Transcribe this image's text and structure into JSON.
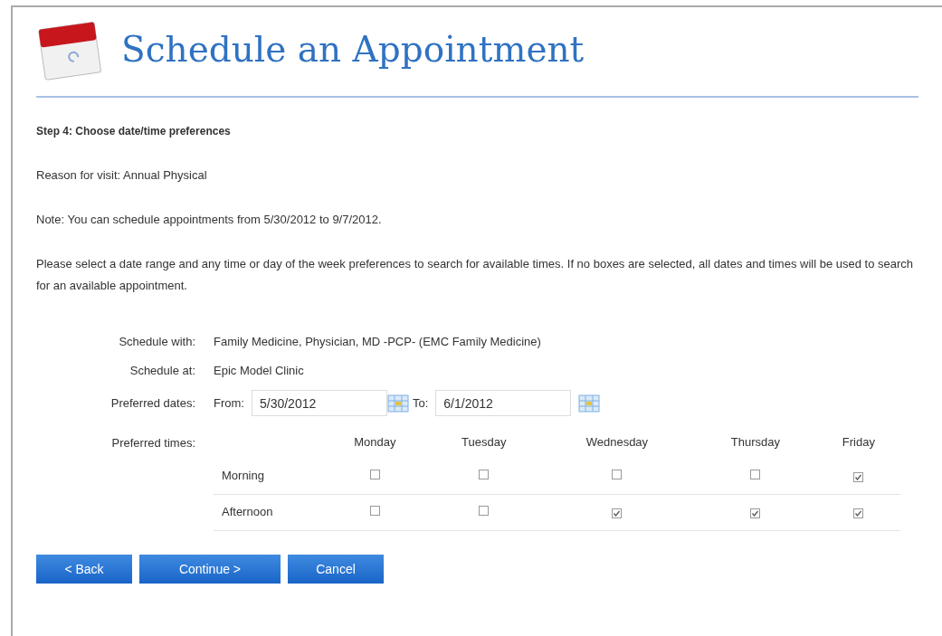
{
  "title": "Schedule an Appointment",
  "step": "Step 4: Choose date/time preferences",
  "paragraphs": [
    "Reason for visit: Annual Physical",
    "Note: You can schedule appointments from 5/30/2012 to 9/7/2012.",
    "Please select a date range and any time or day of the week preferences to search for available times. If no boxes are selected, all dates and times will be used to search for an available appointment."
  ],
  "details": [
    {
      "label": "Schedule with:",
      "value": "Family Medicine, Physician, MD -PCP- (EMC Family Medicine)"
    },
    {
      "label": "Schedule at:",
      "value": "Epic Model Clinic"
    }
  ],
  "dates": {
    "label": "Preferred dates:",
    "from_label": "From:",
    "from_value": "5/30/2012",
    "to_label": "To:",
    "to_value": "6/1/2012"
  },
  "times": {
    "label": "Preferred times:",
    "days": [
      "Monday",
      "Tuesday",
      "Wednesday",
      "Thursday",
      "Friday"
    ],
    "slots": [
      {
        "name": "Morning",
        "checked": [
          false,
          false,
          false,
          false,
          true
        ]
      },
      {
        "name": "Afternoon",
        "checked": [
          false,
          false,
          true,
          true,
          true
        ]
      }
    ]
  },
  "buttons": [
    "< Back",
    "Continue >",
    "Cancel"
  ]
}
